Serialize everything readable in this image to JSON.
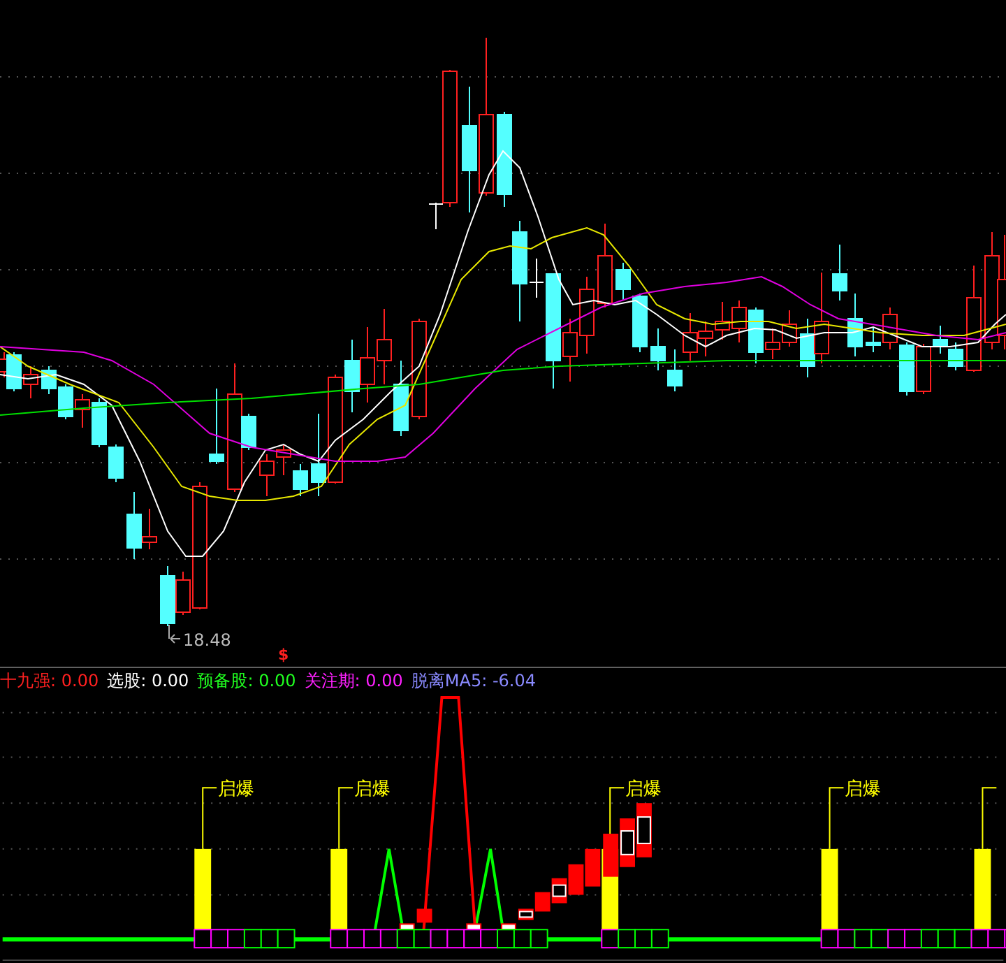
{
  "price_chart": {
    "low_label": "18.48",
    "marker": "$"
  },
  "indicator": {
    "legend": [
      {
        "label": "十九强:",
        "value": "0.00",
        "color": "#ff2020"
      },
      {
        "label": "选股:",
        "value": "0.00",
        "color": "#ffffff"
      },
      {
        "label": "预备股:",
        "value": "0.00",
        "color": "#20ff20"
      },
      {
        "label": "关注期:",
        "value": "0.00",
        "color": "#ff20ff"
      },
      {
        "label": "脱离MA5:",
        "value": "-6.04",
        "color": "#8a8aff"
      }
    ],
    "signal_labels": [
      "启爆",
      "启爆",
      "启爆",
      "启爆"
    ]
  }
}
